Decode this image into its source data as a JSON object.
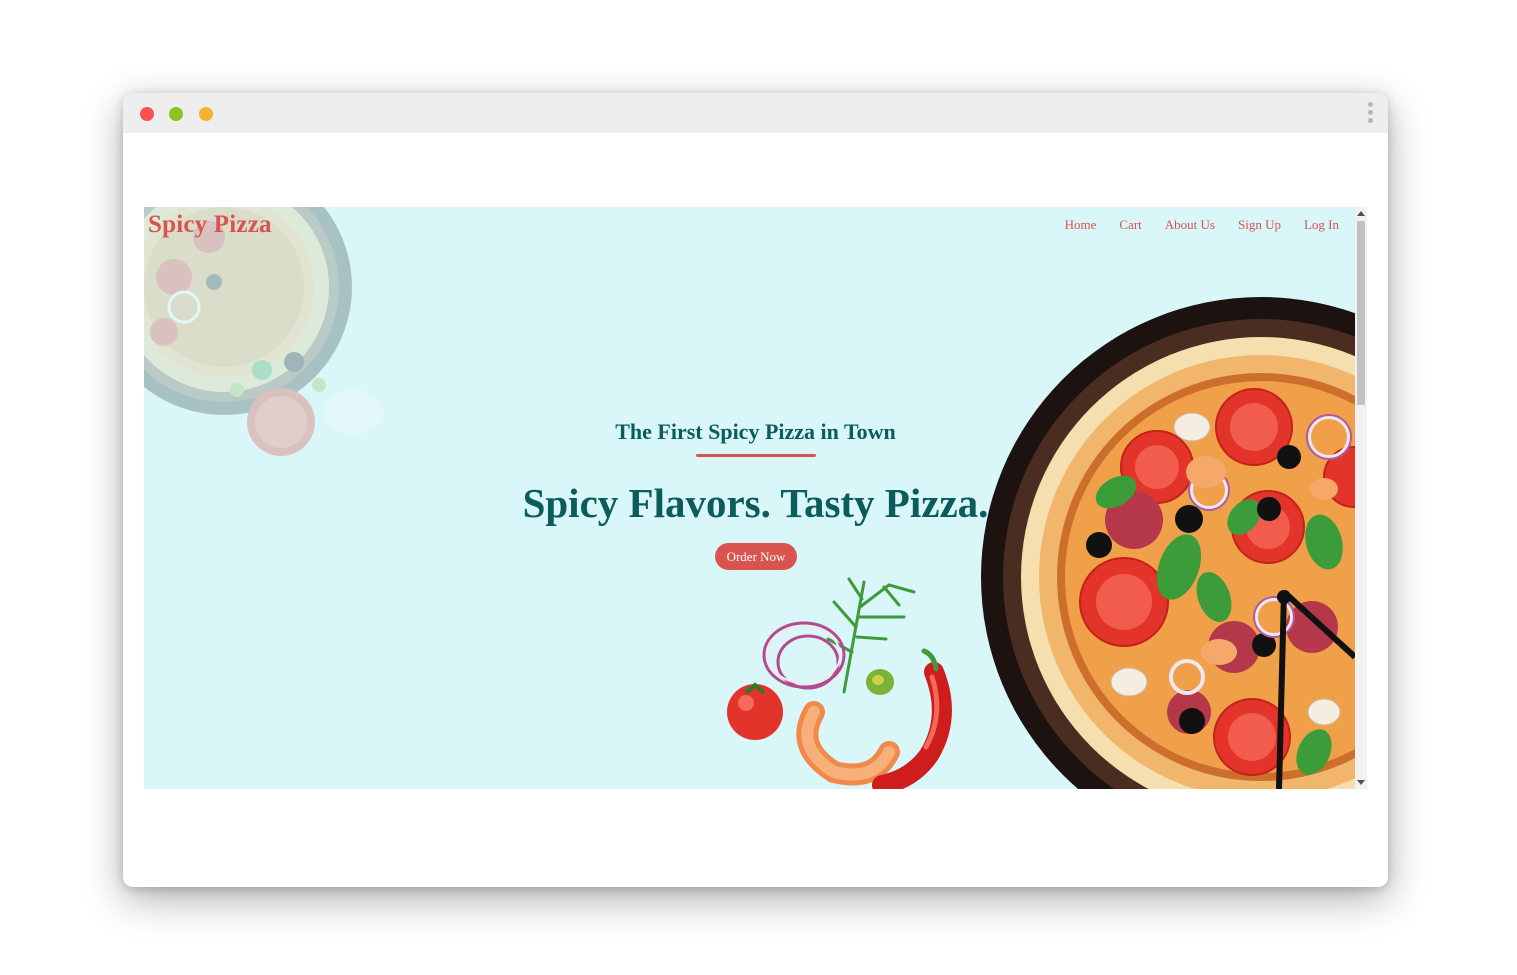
{
  "window": {
    "controls": [
      "close",
      "minimize",
      "maximize"
    ],
    "menu_icon": "more-vertical-icon"
  },
  "site": {
    "brand": "Spicy Pizza",
    "nav": [
      "Home",
      "Cart",
      "About Us",
      "Sign Up",
      "Log In"
    ]
  },
  "hero": {
    "subtitle": "The First Spicy Pizza in Town",
    "headline": "Spicy Flavors. Tasty Pizza.",
    "cta": "Order Now",
    "images": [
      "faded-pizza-illustration",
      "pizza-illustration",
      "ingredients-illustration"
    ]
  },
  "colors": {
    "accent": "#d9534f",
    "heading": "#0b5c5a",
    "hero_background": "#d9f6f9",
    "titlebar": "#eeeeee",
    "close": "#fc4f4f",
    "minimize": "#8dc21f",
    "maximize": "#f9b230"
  }
}
